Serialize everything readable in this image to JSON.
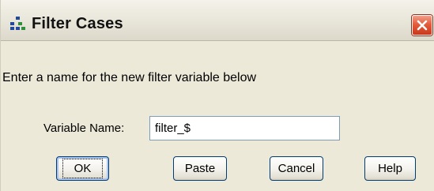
{
  "window": {
    "title": "Filter Cases",
    "title_icon": "filter-cases-icon",
    "close_icon": "close-icon"
  },
  "prompt": "Enter a name for the new filter variable below",
  "variable_name": {
    "label": "Variable Name:",
    "value": "filter_$"
  },
  "buttons": {
    "ok": "OK",
    "paste": "Paste",
    "cancel": "Cancel",
    "help": "Help"
  },
  "colors": {
    "dialog_background": "#ece9d8",
    "close_button": "#e45c3d",
    "button_border": "#003c74"
  }
}
